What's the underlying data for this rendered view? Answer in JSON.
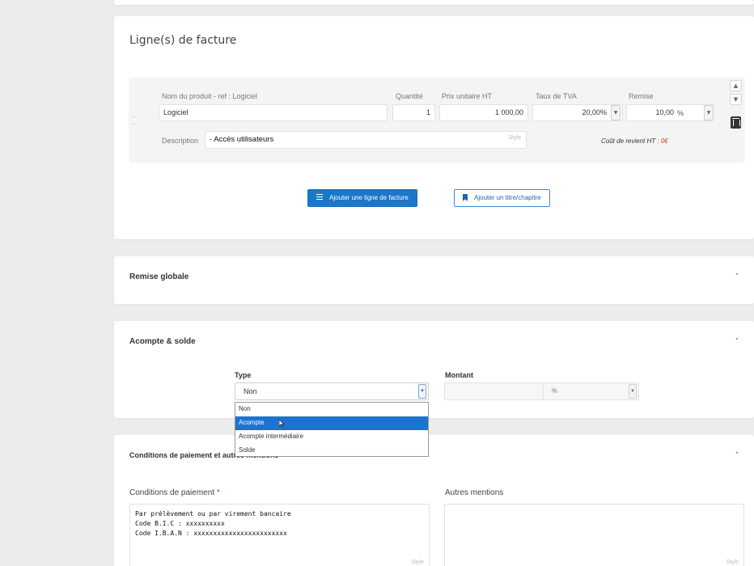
{
  "invoice_lines": {
    "title": "Ligne(s) de facture",
    "columns": {
      "product": "Nom du produit - ref : Logiciel",
      "quantity": "Quantité",
      "unit_price": "Prix unitaire HT",
      "vat": "Taux de TVA",
      "discount": "Remise"
    },
    "row": {
      "product": "Logiciel",
      "quantity": "1",
      "unit_price": "1 000,00",
      "vat": "20,00%",
      "discount": "10,00",
      "discount_unit": "%",
      "description_label": "Description",
      "description": "- Accès utilisateurs",
      "style_hint": "Style",
      "cost_label": "Coût de revient HT : ",
      "cost_value": "0€"
    },
    "add_line_button": "Ajouter une ligne de facture",
    "add_title_button": "Ajouter un titre/chapitre"
  },
  "global_discount": {
    "title": "Remise globale"
  },
  "deposit": {
    "title": "Acompte & solde",
    "type_label": "Type",
    "type_value": "Non",
    "amount_label": "Montant",
    "amount_value": "",
    "amount_unit": "%",
    "options": [
      "Non",
      "Acompte",
      "Acompte intermédiaire",
      "Solde"
    ],
    "highlighted_option": "Acompte"
  },
  "conditions": {
    "title": "Conditions de paiement et autres mentions",
    "payment_label": "Conditions de paiement",
    "required_mark": "*",
    "payment_text": "Par prélèvement ou par virement bancaire\nCode B.I.C : xxxxxxxxxx\nCode I.B.A.N : xxxxxxxxxxxxxxxxxxxxxxxx",
    "other_label": "Autres mentions",
    "other_text": "",
    "style_hint": "Style"
  },
  "colors": {
    "primary": "#1a77c9",
    "dropdown_highlight": "#1c74d1",
    "required": "#c0392b",
    "background": "#ececec"
  }
}
